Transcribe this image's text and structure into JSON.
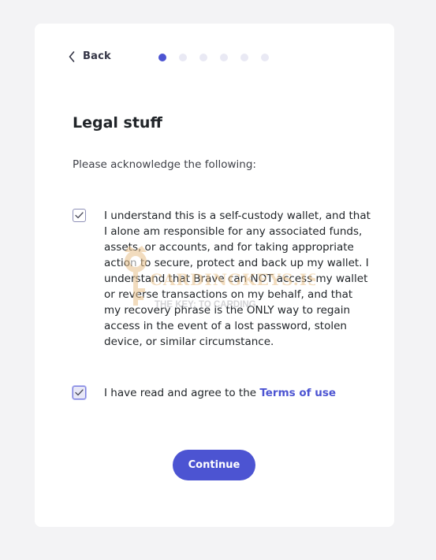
{
  "header": {
    "back_label": "Back",
    "steps": {
      "total": 6,
      "current": 1
    }
  },
  "page": {
    "title": "Legal stuff",
    "subtitle": "Please acknowledge the following:"
  },
  "acknowledgements": [
    {
      "checked": true,
      "text": "I understand this is a self-custody wallet, and that I alone am responsible for any associated funds, assets, or accounts, and for taking appropriate action to secure, protect and back up my wallet. I understand that Brave can NOT access my wallet or reverse transactions on my behalf, and that my recovery phrase is the ONLY way to regain access in the event of a lost password, stolen device, or similar circumstance."
    },
    {
      "checked": true,
      "text_prefix": "I have read and agree to the ",
      "link_label": "Terms of use"
    }
  ],
  "actions": {
    "continue_label": "Continue"
  },
  "watermark": {
    "brand": "CARDINGKEYS.IS",
    "tagline": "THE KEY: TO CARDING"
  },
  "colors": {
    "accent": "#4c54d2",
    "background": "#f3f3f5",
    "card": "#ffffff",
    "dot_inactive": "#e9e9f4"
  }
}
